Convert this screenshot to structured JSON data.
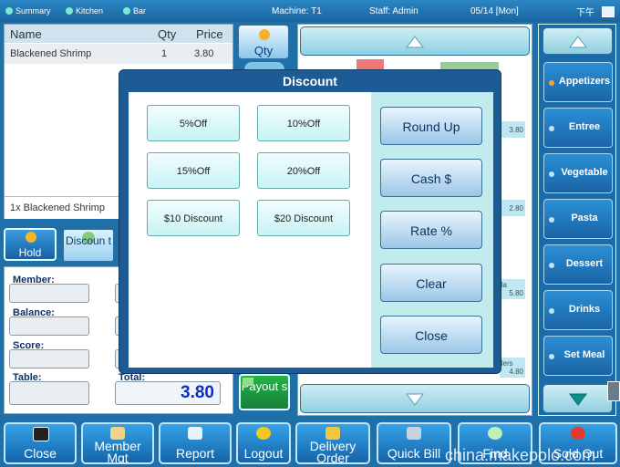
{
  "topbar": {
    "tabs": [
      "Summary",
      "Kitchen",
      "Bar"
    ],
    "machine": "Machine: T1",
    "staff": "Staff: Admin",
    "date": "05/14 [Mon]",
    "time": "下午"
  },
  "order": {
    "columns": [
      "Name",
      "Qty",
      "Price"
    ],
    "rows": [
      {
        "name": "Blackened Shrimp",
        "qty": "1",
        "price": "3.80"
      }
    ],
    "note": "1x Blackened Shrimp"
  },
  "actions": {
    "hold": "Hold",
    "discount": "Discoun t",
    "qty": "Qty",
    "payout": "Payout s"
  },
  "customer": {
    "member_label": "Member:",
    "balance_label": "Balance:",
    "score_label": "Score:",
    "table_label": "Table:",
    "total_label": "Total:",
    "total_value": "3.80"
  },
  "modal": {
    "title": "Discount",
    "presets": [
      "5%Off",
      "10%Off",
      "15%Off",
      "20%Off",
      "$10 Discount",
      "$20 Discount"
    ],
    "actions": [
      "Round Up",
      "Cash $",
      "Rate %",
      "Clear",
      "Close"
    ]
  },
  "menu_items_visible": {
    "prices": [
      "3.80",
      "2.80",
      "5.80",
      "4.80"
    ],
    "fragments": [
      "lla",
      "llers"
    ]
  },
  "categories": [
    "Appetizers",
    "Entree",
    "Vegetable",
    "Pasta",
    "Dessert",
    "Drinks",
    "Set Meal"
  ],
  "toolbar": [
    "Close",
    "Member Mgt",
    "Report",
    "Logout",
    "Delivery Order",
    "Quick Bill",
    "Find",
    "Sold Out"
  ],
  "watermark": "china.makepolo.com"
}
